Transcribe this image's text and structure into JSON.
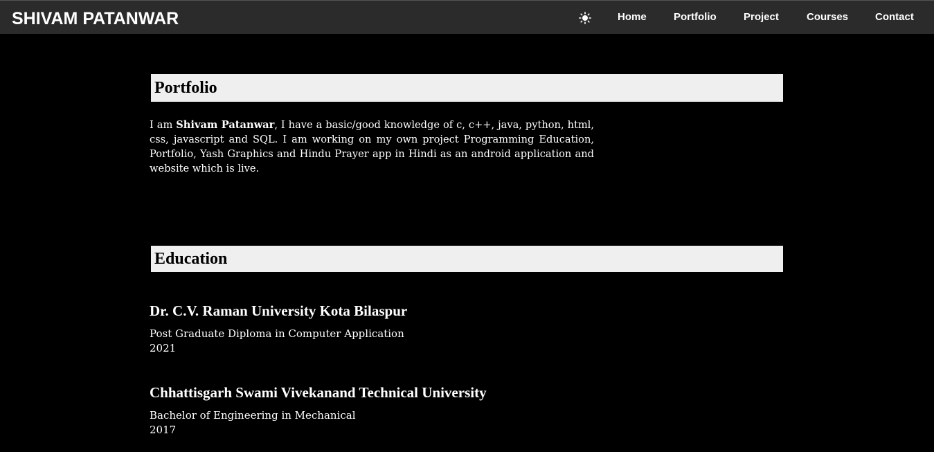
{
  "header": {
    "brand": "SHIVAM PATANWAR",
    "theme_icon": "sun-icon",
    "nav": [
      "Home",
      "Portfolio",
      "Project",
      "Courses",
      "Contact"
    ]
  },
  "portfolio": {
    "heading": "Portfolio",
    "intro_prefix": "I am ",
    "intro_name": "Shivam Patanwar",
    "intro_rest": ", I have a basic/good knowledge of c, c++, java, python, html, css, javascript and SQL. I am working on my own project Programming Education, Portfolio, Yash Graphics and Hindu Prayer app in Hindi as an android application and website which is live."
  },
  "education": {
    "heading": "Education",
    "entries": [
      {
        "institution": "Dr. C.V. Raman University Kota Bilaspur",
        "degree": "Post Graduate Diploma in Computer Application",
        "year": "2021"
      },
      {
        "institution": "Chhattisgarh Swami Vivekanand Technical University",
        "degree": "Bachelor of Engineering in Mechanical",
        "year": "2017"
      }
    ]
  },
  "colors": {
    "page_background": "#000000",
    "navbar_background": "#2b2b2b",
    "header_band": "#efefef",
    "text": "#ffffff"
  }
}
